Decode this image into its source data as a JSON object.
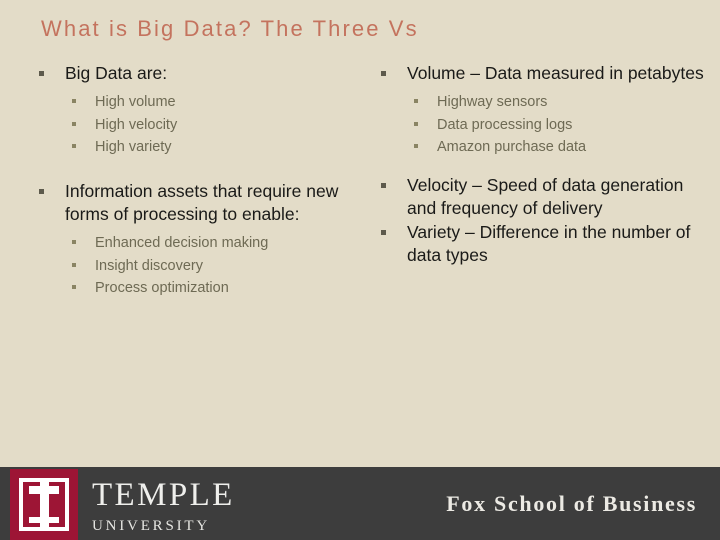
{
  "slide": {
    "title": "What is Big Data? The Three Vs",
    "background_color": "#e3dcc8",
    "title_color": "#c4735e"
  },
  "left_column": {
    "blocks": [
      {
        "heading": "Big Data are:",
        "sub_items": [
          "High volume",
          "High velocity",
          "High variety"
        ]
      },
      {
        "heading": "Information assets that require new forms of processing to enable:",
        "sub_items": [
          "Enhanced decision making",
          "Insight discovery",
          "Process optimization"
        ]
      }
    ]
  },
  "right_column": {
    "blocks": [
      {
        "heading": "Volume – Data measured in petabytes",
        "sub_items": [
          "Highway sensors",
          "Data processing logs",
          "Amazon purchase data"
        ]
      },
      {
        "heading": "Velocity – Speed of data generation and frequency of delivery",
        "sub_items": []
      },
      {
        "heading": "Variety – Difference in the number of data types",
        "sub_items": []
      }
    ]
  },
  "footer": {
    "background_color": "#3d3d3d",
    "logo": {
      "mark_color": "#9d1535",
      "name": "TEMPLE",
      "subtitle": "UNIVERSITY"
    },
    "school_name": "Fox School of Business"
  }
}
